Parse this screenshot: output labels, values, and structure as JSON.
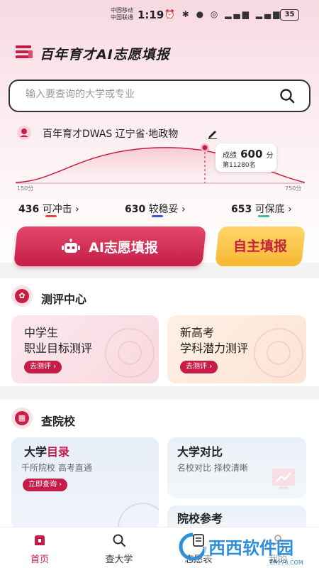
{
  "status_bar": {
    "carrier_1": "中国移动",
    "carrier_2": "中国联通",
    "time": "1:19",
    "battery": "35"
  },
  "header": {
    "title": "百年育才AI志愿填报"
  },
  "search": {
    "placeholder": "输入要查询的大学或专业"
  },
  "profile": {
    "text": "百年育才DWAS 辽宁省·地政物"
  },
  "score": {
    "label": "成绩",
    "value": "600",
    "unit": "分",
    "rank": "第11280名",
    "axis_min": "150分",
    "axis_max": "750分"
  },
  "tiers": [
    {
      "score": "436",
      "label": "可冲击",
      "arrow": "›",
      "color": "#e04a3c"
    },
    {
      "score": "630",
      "label": "较稳妥",
      "arrow": "›",
      "color": "#3a5bd9"
    },
    {
      "score": "653",
      "label": "可保底",
      "arrow": "›",
      "color": "#3fbf8f"
    }
  ],
  "buttons": {
    "ai_fill": "AI志愿填报",
    "self_fill": "自主填报"
  },
  "eval_center": {
    "title": "测评中心",
    "cards": [
      {
        "line1": "中学生",
        "line2": "职业目标测评",
        "action": "去测评 ›"
      },
      {
        "line1": "新高考",
        "line2": "学科潜力测评",
        "action": "去测评 ›"
      }
    ]
  },
  "school_search": {
    "title": "查院校",
    "catalog": {
      "title_a": "大学",
      "title_b": "目录",
      "sub": "千所院校  高考直通",
      "action": "立即查询 ›"
    },
    "compare": {
      "title": "大学对比",
      "sub": "名校对比  择校清晰"
    },
    "reference": {
      "title": "院校参考"
    }
  },
  "nav": {
    "items": [
      {
        "label": "首页"
      },
      {
        "label": "查大学"
      },
      {
        "label": "志愿表"
      },
      {
        "label": "我的"
      }
    ]
  },
  "watermark": {
    "text": "西西软件园",
    "domain": "CR173.COM"
  },
  "colors": {
    "brand": "#c51d47",
    "accent_yellow": "#f7b731"
  }
}
